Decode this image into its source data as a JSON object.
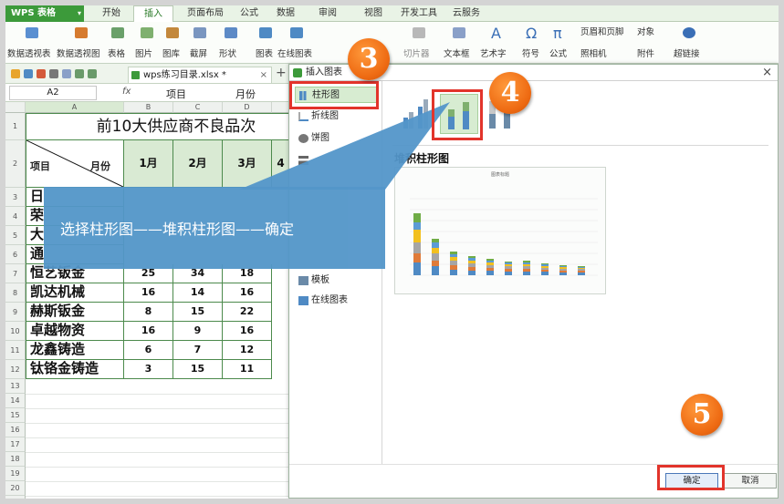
{
  "app": {
    "menu_label": "WPS 表格"
  },
  "tabs": [
    "开始",
    "插入",
    "页面布局",
    "公式",
    "数据",
    "审阅",
    "视图",
    "开发工具",
    "云服务"
  ],
  "active_tab": "插入",
  "ribbon": {
    "items": [
      "数据透视表",
      "数据透视图",
      "表格",
      "图片",
      "图库",
      "截屏",
      "形状",
      "图表",
      "在线图表",
      "切片器",
      "文本框",
      "艺术字",
      "符号",
      "公式",
      "页眉和页脚",
      "对象",
      "照相机",
      "附件",
      "超链接"
    ]
  },
  "document": {
    "filename": "wps练习目录.xlsx *"
  },
  "formula_bar": {
    "cell_ref": "A2",
    "fx_label": "fx",
    "content_a": "项目",
    "content_b": "月份"
  },
  "sheet": {
    "columns": [
      "A",
      "B",
      "C",
      "D"
    ],
    "title": "前10大供应商不良品次",
    "header_item": "项目",
    "header_month": "月份",
    "months": [
      "1月",
      "2月",
      "3月",
      "4"
    ],
    "rows": [
      {
        "name": "日",
        "v": [
          "",
          "",
          ""
        ]
      },
      {
        "name": "荣",
        "v": [
          "",
          "",
          ""
        ]
      },
      {
        "name": "大",
        "v": [
          "",
          "",
          ""
        ]
      },
      {
        "name": "通",
        "v": [
          "",
          "",
          ""
        ]
      },
      {
        "name": "恒艺钣金",
        "v": [
          "25",
          "34",
          "18"
        ]
      },
      {
        "name": "凯达机械",
        "v": [
          "16",
          "14",
          "16"
        ]
      },
      {
        "name": "赫斯钣金",
        "v": [
          "8",
          "15",
          "22"
        ]
      },
      {
        "name": "卓越物资",
        "v": [
          "16",
          "9",
          "16"
        ]
      },
      {
        "name": "龙鑫铸造",
        "v": [
          "6",
          "7",
          "12"
        ]
      },
      {
        "name": "钛铬金铸造",
        "v": [
          "3",
          "15",
          "11"
        ]
      }
    ],
    "row_numbers": [
      "1",
      "2",
      "3",
      "4",
      "5",
      "6",
      "7",
      "8",
      "9",
      "10",
      "11",
      "12",
      "13",
      "14",
      "15",
      "16",
      "17",
      "18",
      "19",
      "20",
      "21"
    ]
  },
  "dialog": {
    "title": "插入图表",
    "chart_types": [
      "柱形图",
      "折线图",
      "饼图",
      "模板",
      "在线图表"
    ],
    "selected_type": "柱形图",
    "preview_title": "堆积柱形图",
    "preview_inner_title": "图表标题",
    "ok_label": "确定",
    "cancel_label": "取消"
  },
  "callouts": {
    "step3": "3",
    "step4": "4",
    "step5": "5",
    "instruction": "选择柱形图——堆积柱形图——确定"
  },
  "colors": {
    "accent_green": "#3c9a3a",
    "callout_red": "#e2342b",
    "badge_orange": "#ee6a12",
    "banner_blue": "#5396c9"
  }
}
